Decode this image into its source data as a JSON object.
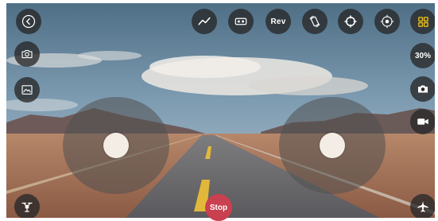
{
  "toolbar": {
    "rev_label": "Rev"
  },
  "right_panel": {
    "speed_label": "30%"
  },
  "controls": {
    "stop_label": "Stop"
  },
  "colors": {
    "button_bg": "#282828",
    "grid_icon": "#f5c518",
    "stop_bg": "#c9404f",
    "knob": "#f3ede6"
  },
  "icons": {
    "back": "chevron-left-icon",
    "trajectory": "zigzag-line-icon",
    "vr": "vr-goggles-icon",
    "gravity": "phone-rotate-icon",
    "headless": "crosshair-icon",
    "calibrate": "target-icon",
    "menu": "grid-icon",
    "photo_album": "camera-outline-icon",
    "video_album": "image-icon",
    "take_photo": "camera-icon",
    "record_video": "video-camera-icon",
    "takeoff_land": "drone-icon",
    "fly": "airplane-icon"
  }
}
